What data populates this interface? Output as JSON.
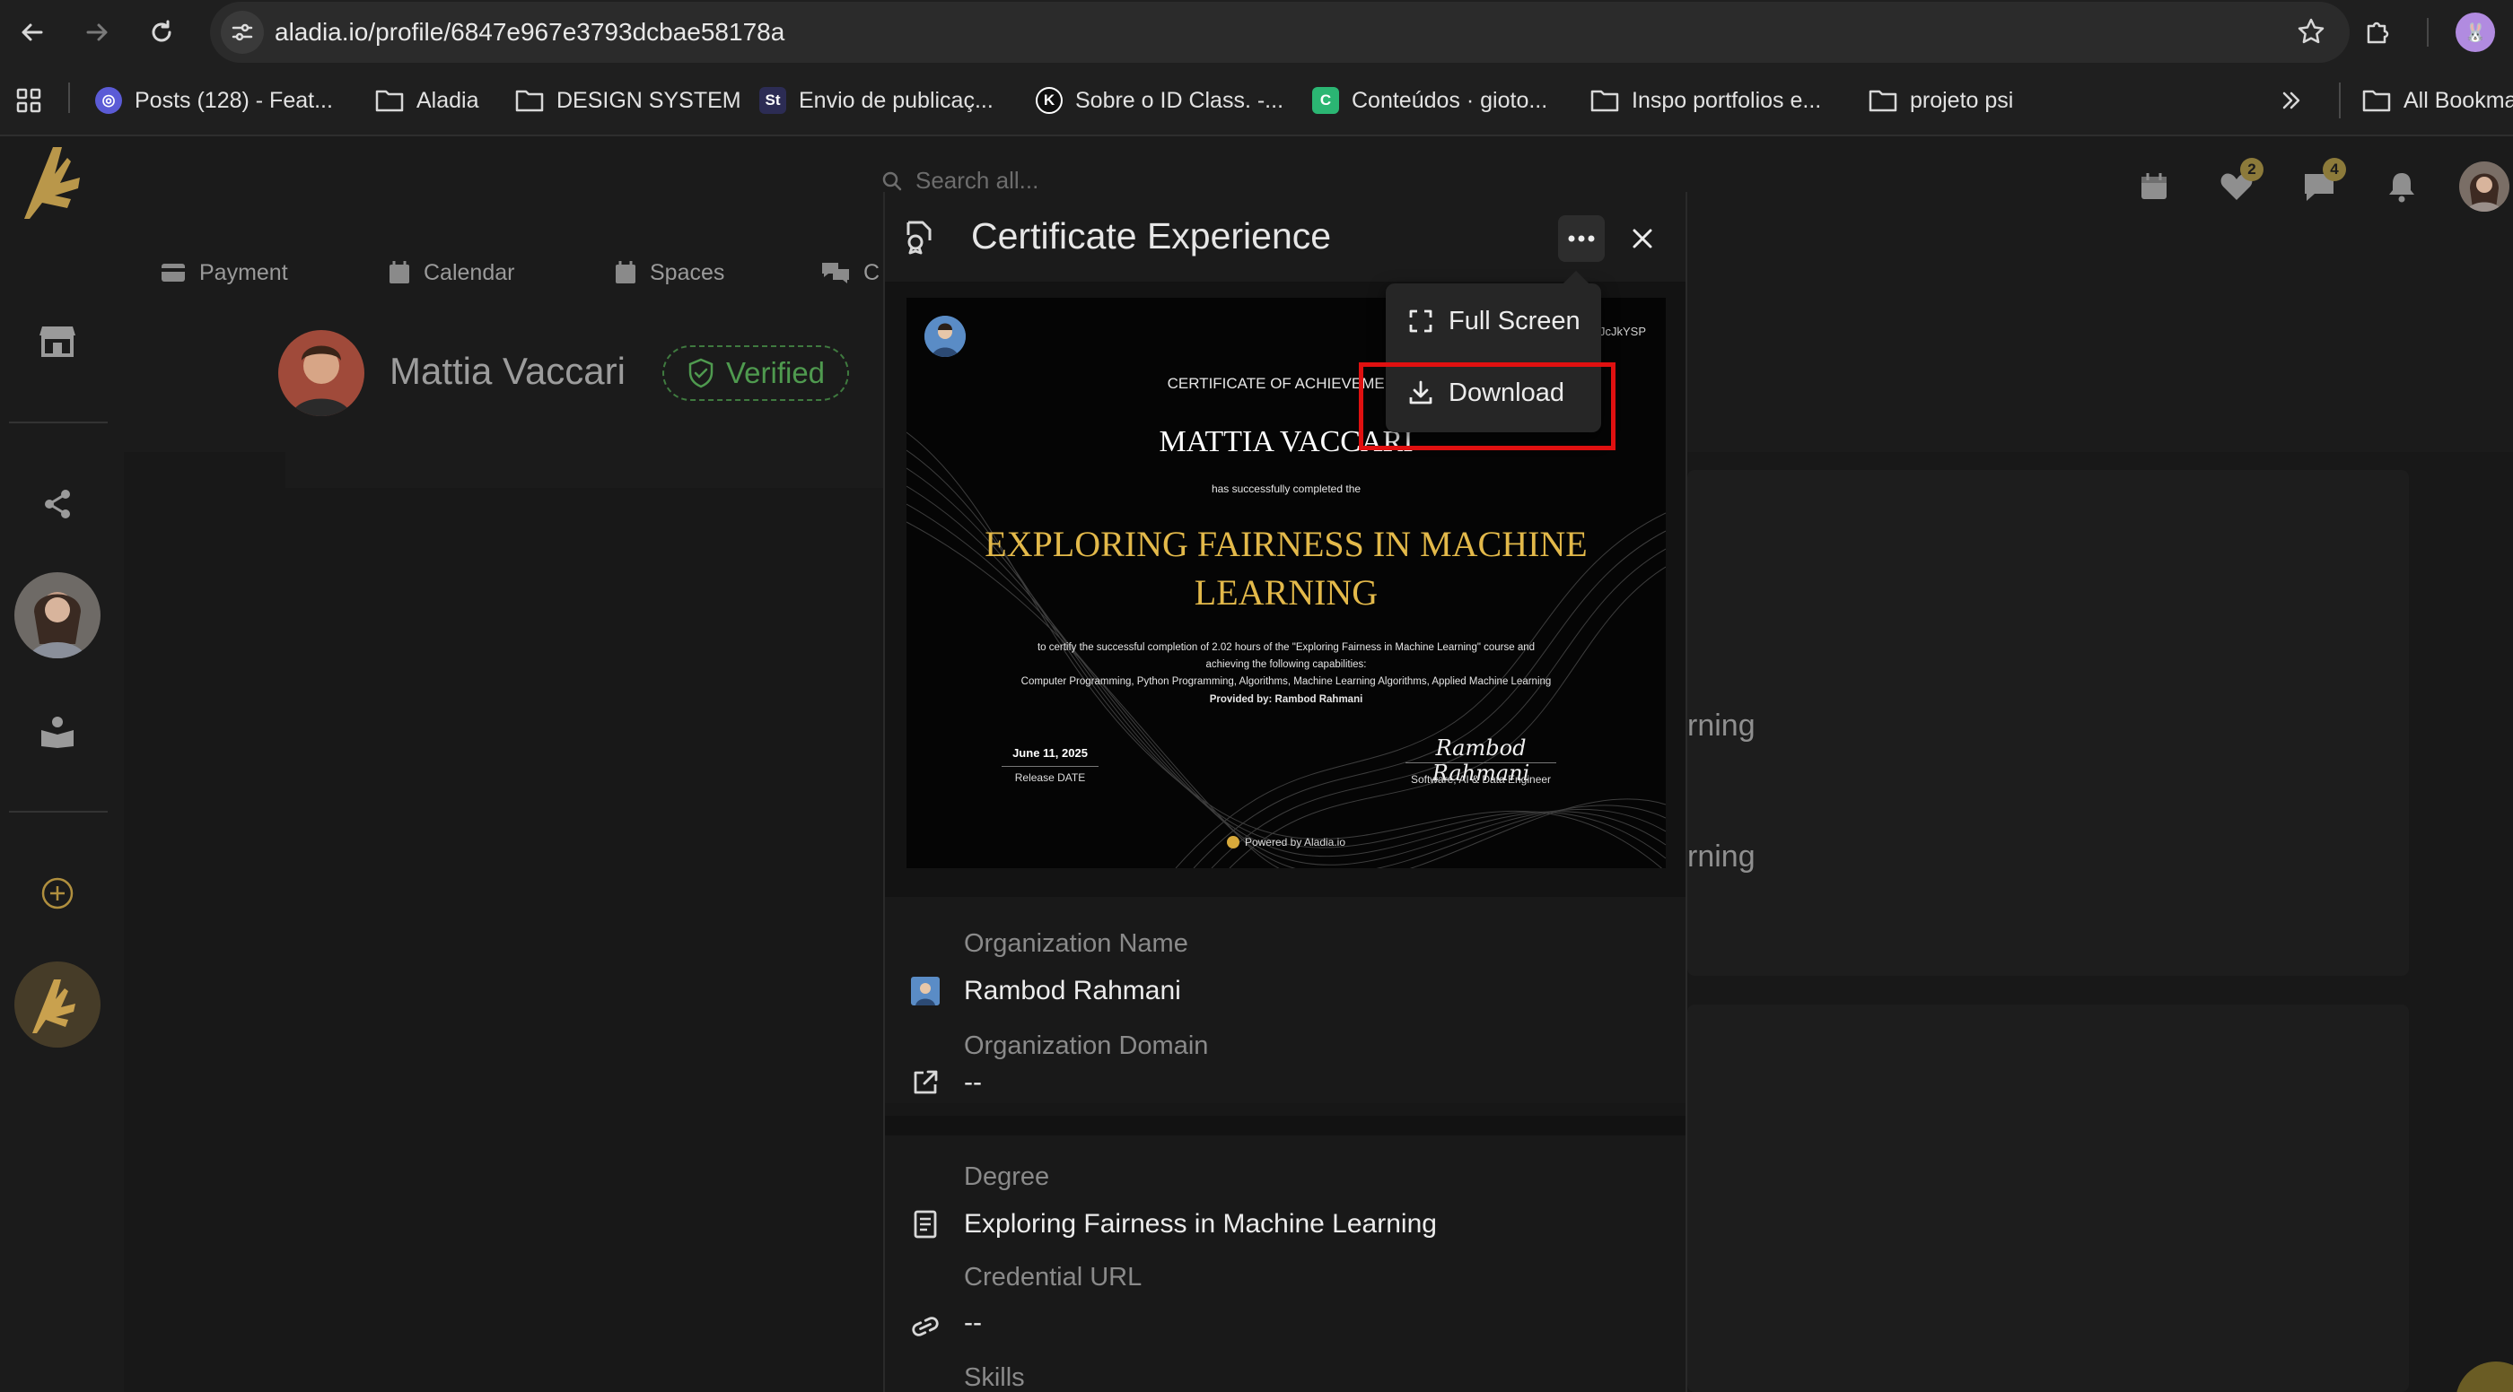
{
  "browser": {
    "url": "aladia.io/profile/6847e967e3793dcbae58178a",
    "bookmarks": [
      {
        "label": "Posts (128) - Feat...",
        "icon": "app-favicon-icon",
        "color": "#5b5bd6"
      },
      {
        "label": "Aladia",
        "icon": "folder-icon"
      },
      {
        "label": "DESIGN SYSTEM",
        "icon": "folder-icon"
      },
      {
        "label": "Envio de publicaç...",
        "icon": "st-favicon-icon",
        "color": "#2c2c54"
      },
      {
        "label": "Sobre o ID Class. -...",
        "icon": "k-favicon-icon",
        "color": "#1a1a1a"
      },
      {
        "label": "Conteúdos · gioto...",
        "icon": "c-favicon-icon",
        "color": "#2bb673"
      },
      {
        "label": "Inspo portfolios e...",
        "icon": "folder-icon"
      },
      {
        "label": "projeto psi",
        "icon": "folder-icon"
      }
    ],
    "all_bookmarks": "All Bookma"
  },
  "app": {
    "search_placeholder": "Search all...",
    "notifications": {
      "likes": "2",
      "messages": "4"
    },
    "tabs": [
      "Payment",
      "Calendar",
      "Spaces",
      "C"
    ],
    "profile_name": "Mattia Vaccari",
    "verified_label": "Verified",
    "background_texts": [
      "rning",
      "rning"
    ],
    "accent": "#d7a93b"
  },
  "modal": {
    "title": "Certificate Experience",
    "menu": {
      "full_screen": "Full Screen",
      "download": "Download"
    },
    "certificate": {
      "id_fragment": "JcJkYSP",
      "heading": "CERTIFICATE OF ACHIEVEMENT",
      "recipient": "MATTIA VACCARI",
      "completed_text": "has successfully completed the",
      "course": "EXPLORING FAIRNESS IN MACHINE LEARNING",
      "body_line1": "to certify the successful completion of 2.02 hours of the \"Exploring Fairness in Machine Learning\" course and",
      "body_line2": "achieving the following capabilities:",
      "body_line3": "Computer Programming, Python Programming, Algorithms, Machine Learning Algorithms, Applied Machine Learning",
      "provided_by": "Provided by: Rambod Rahmani",
      "date": "June 11, 2025",
      "date_label": "Release DATE",
      "signature": "Rambod Rahmani",
      "signer_role": "Software, AI & Data Engineer",
      "powered_by": "Powered by Aladia.io"
    },
    "fields": {
      "org_name_label": "Organization Name",
      "org_name": "Rambod Rahmani",
      "org_domain_label": "Organization Domain",
      "org_domain": "--",
      "degree_label": "Degree",
      "degree": "Exploring Fairness in Machine Learning",
      "credential_url_label": "Credential URL",
      "credential_url": "--",
      "skills_label": "Skills"
    }
  }
}
